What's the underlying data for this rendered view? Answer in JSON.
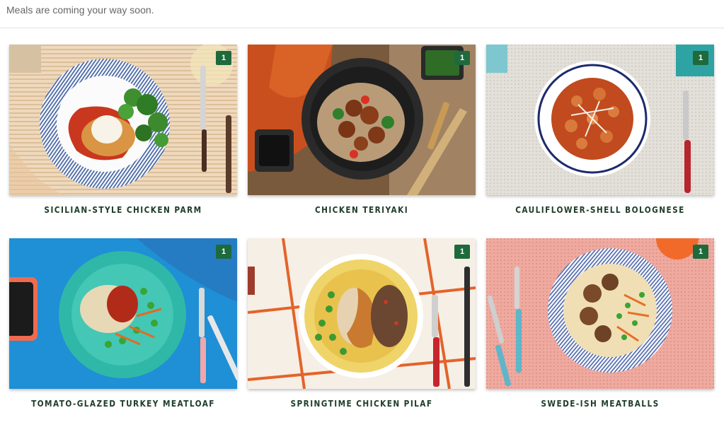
{
  "banner": {
    "text": "Meals are coming your way soon."
  },
  "brand": {
    "badge_color": "#1e6a3c",
    "title_color": "#1f3d2b"
  },
  "meals": [
    {
      "title": "SICILIAN-STYLE CHICKEN PARM",
      "quantity": "1"
    },
    {
      "title": "CHICKEN TERIYAKI",
      "quantity": "1"
    },
    {
      "title": "CAULIFLOWER-SHELL BOLOGNESE",
      "quantity": "1"
    },
    {
      "title": "TOMATO-GLAZED TURKEY MEATLOAF",
      "quantity": "1"
    },
    {
      "title": "SPRINGTIME CHICKEN PILAF",
      "quantity": "1"
    },
    {
      "title": "SWEDE-ISH MEATBALLS",
      "quantity": "1"
    }
  ]
}
